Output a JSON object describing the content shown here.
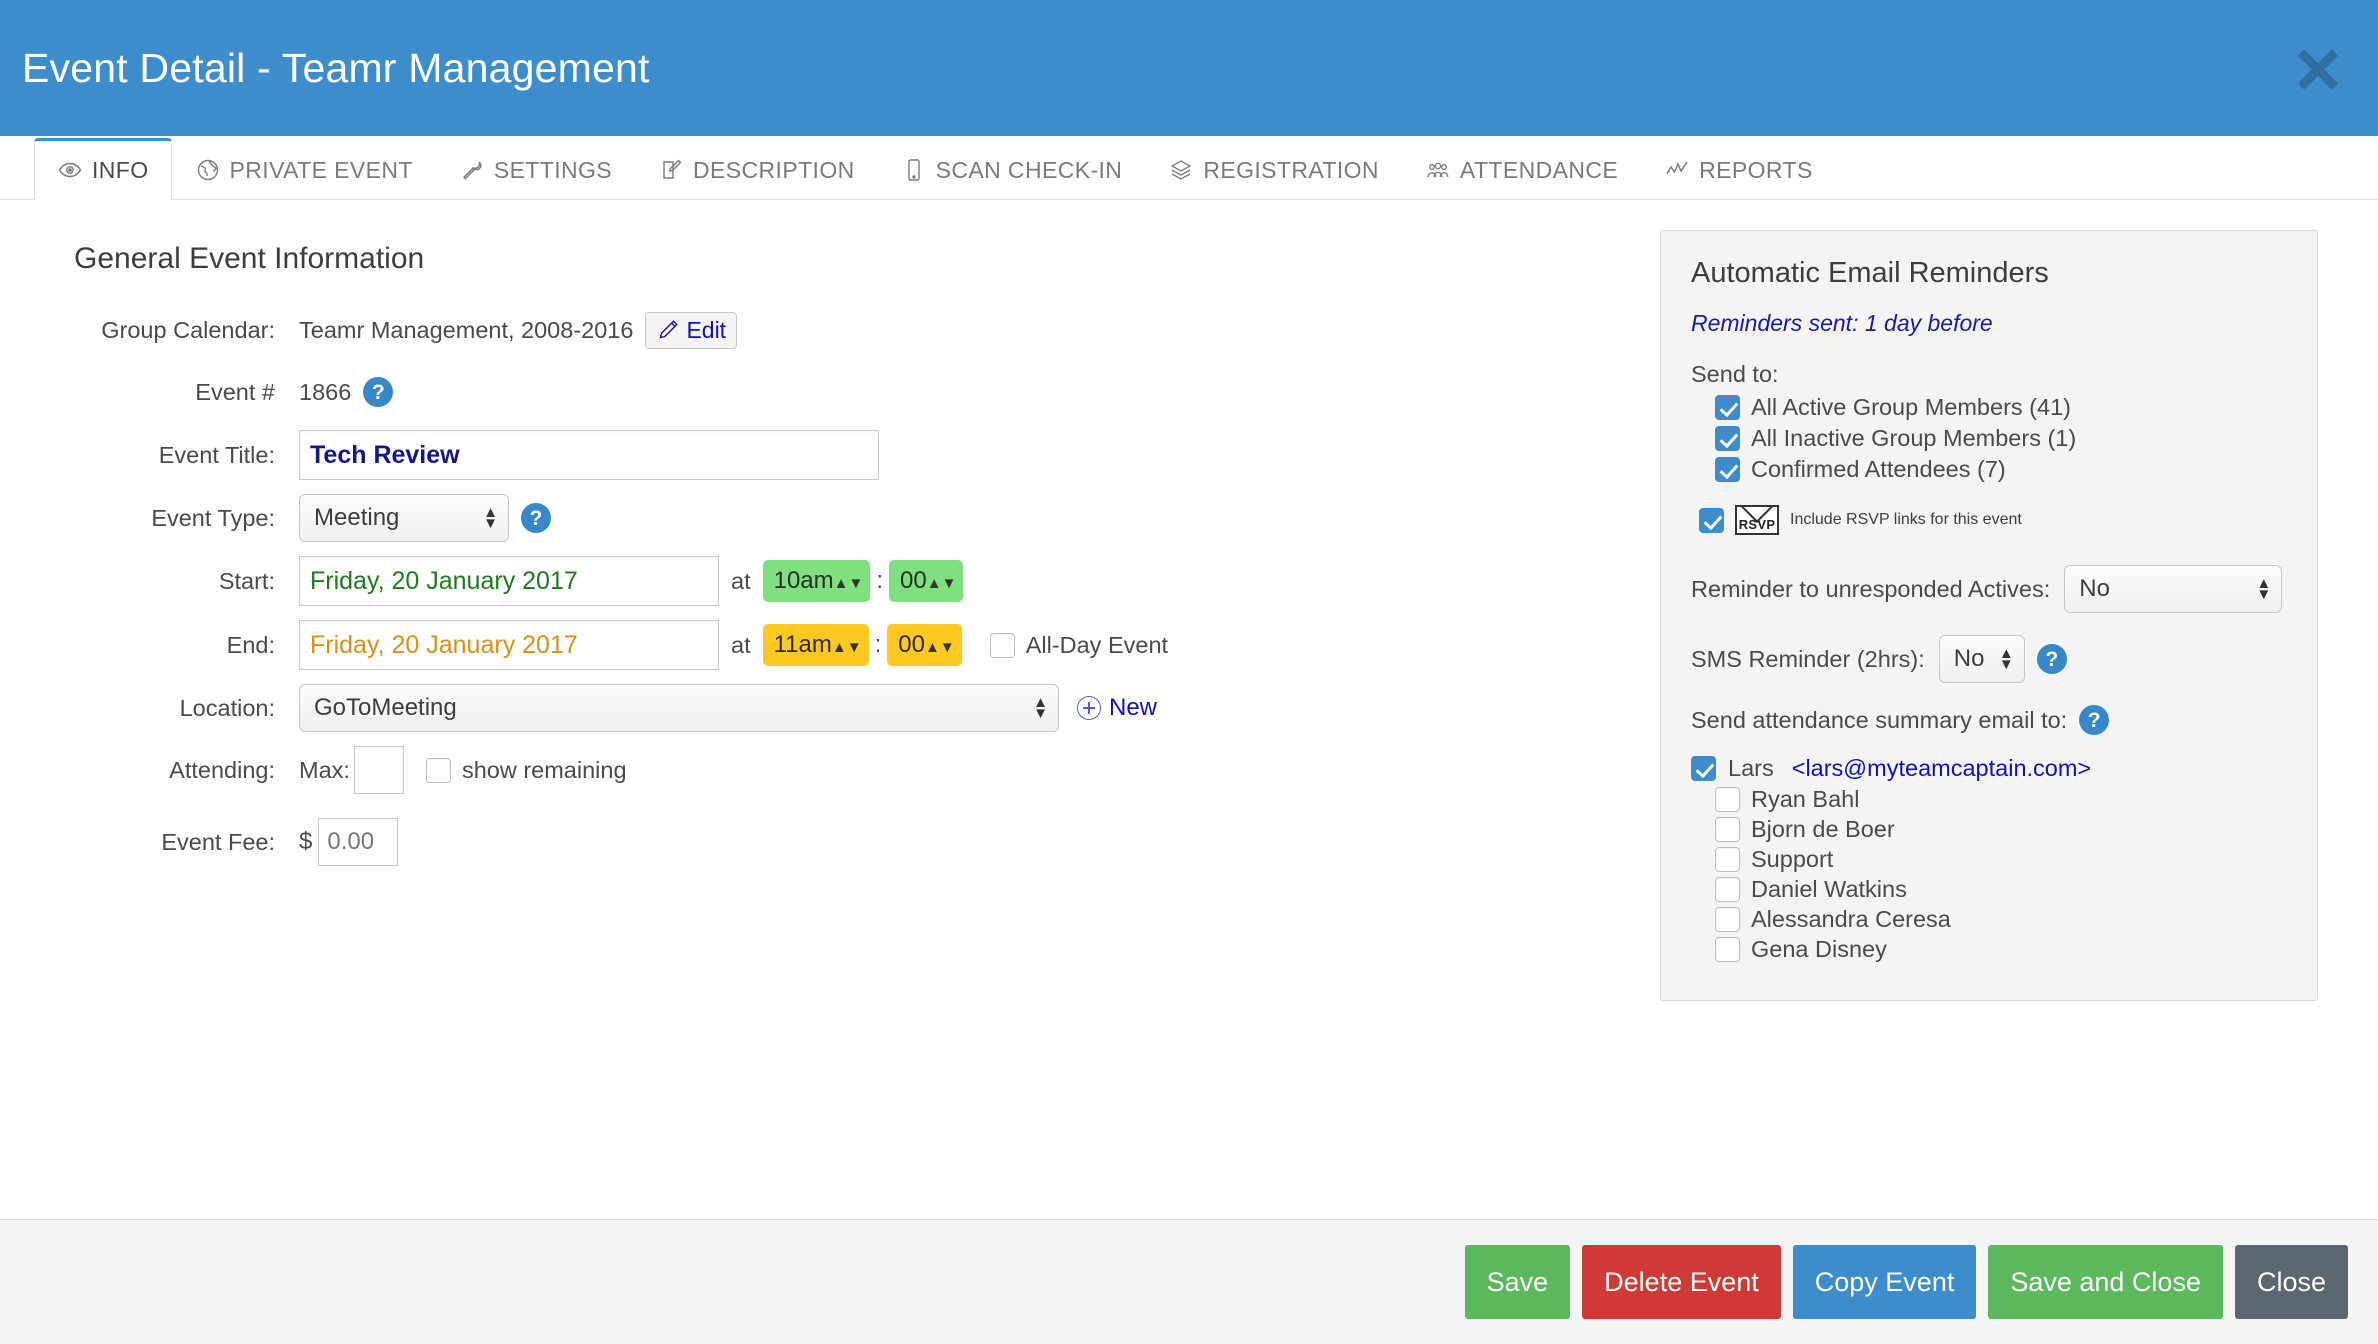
{
  "window": {
    "title": "Event Detail - Teamr Management",
    "close_icon": "close-icon",
    "header_bg": "#3d8dcc"
  },
  "tabs": [
    {
      "label": "INFO",
      "icon": "eye-icon",
      "active": true
    },
    {
      "label": "PRIVATE EVENT",
      "icon": "globe-icon",
      "active": false
    },
    {
      "label": "SETTINGS",
      "icon": "wrench-icon",
      "active": false
    },
    {
      "label": "DESCRIPTION",
      "icon": "note-pencil-icon",
      "active": false
    },
    {
      "label": "SCAN CHECK-IN",
      "icon": "phone-icon",
      "active": false
    },
    {
      "label": "REGISTRATION",
      "icon": "layers-icon",
      "active": false
    },
    {
      "label": "ATTENDANCE",
      "icon": "people-icon",
      "active": false
    },
    {
      "label": "REPORTS",
      "icon": "chart-line-icon",
      "active": false
    }
  ],
  "general": {
    "section_title": "General Event Information",
    "group_calendar_label": "Group Calendar:",
    "group_calendar_value": "Teamr Management, 2008-2016",
    "edit_label": "Edit",
    "event_number_label": "Event #",
    "event_number_value": "1866",
    "event_title_label": "Event Title:",
    "event_title_value": "Tech Review",
    "event_type_label": "Event Type:",
    "event_type_value": "Meeting",
    "start_label": "Start:",
    "start_date": "Friday, 20 January 2017",
    "start_hour": "10am",
    "start_minute": "00",
    "end_label": "End:",
    "end_date": "Friday, 20 January 2017",
    "end_hour": "11am",
    "end_minute": "00",
    "at_word": "at",
    "colon": ":",
    "all_day_label": "All-Day Event",
    "all_day_checked": false,
    "location_label": "Location:",
    "location_value": "GoToMeeting",
    "new_label": "New",
    "attending_label": "Attending:",
    "max_label": "Max:",
    "max_value": "",
    "show_remaining_label": "show remaining",
    "show_remaining_checked": false,
    "event_fee_label": "Event Fee:",
    "currency_symbol": "$",
    "event_fee_placeholder": "0.00",
    "help_icon": "?",
    "start_color": "#7ee07e",
    "end_color": "#ffc823"
  },
  "reminders": {
    "title": "Automatic Email Reminders",
    "sent_note": "Reminders sent: 1 day before",
    "send_to_label": "Send to:",
    "send_to": [
      {
        "label": "All Active Group Members (41)",
        "checked": true
      },
      {
        "label": "All Inactive Group Members (1)",
        "checked": true
      },
      {
        "label": "Confirmed Attendees (7)",
        "checked": true
      }
    ],
    "rsvp_label": "Include RSVP links for this event",
    "rsvp_checked": true,
    "rsvp_badge_text": "RSVP",
    "unresponded_label": "Reminder to unresponded Actives:",
    "unresponded_value": "No",
    "sms_label": "SMS Reminder (2hrs):",
    "sms_value": "No",
    "summary_label": "Send attendance summary email to:",
    "help_icon": "?",
    "primary_recipient": {
      "name": "Lars",
      "email": "<lars@myteamcaptain.com>",
      "checked": true
    },
    "recipients": [
      {
        "label": "Ryan Bahl",
        "checked": false
      },
      {
        "label": "Bjorn de Boer",
        "checked": false
      },
      {
        "label": "Support",
        "checked": false
      },
      {
        "label": "Daniel Watkins",
        "checked": false
      },
      {
        "label": "Alessandra Ceresa",
        "checked": false
      },
      {
        "label": "Gena Disney",
        "checked": false
      }
    ]
  },
  "footer": {
    "save": "Save",
    "delete": "Delete Event",
    "copy": "Copy Event",
    "save_and_close": "Save and Close",
    "close": "Close",
    "save_color": "#5cb85c",
    "delete_color": "#cf3a36",
    "copy_color": "#3d8dcc",
    "close_color": "#5b6670"
  }
}
